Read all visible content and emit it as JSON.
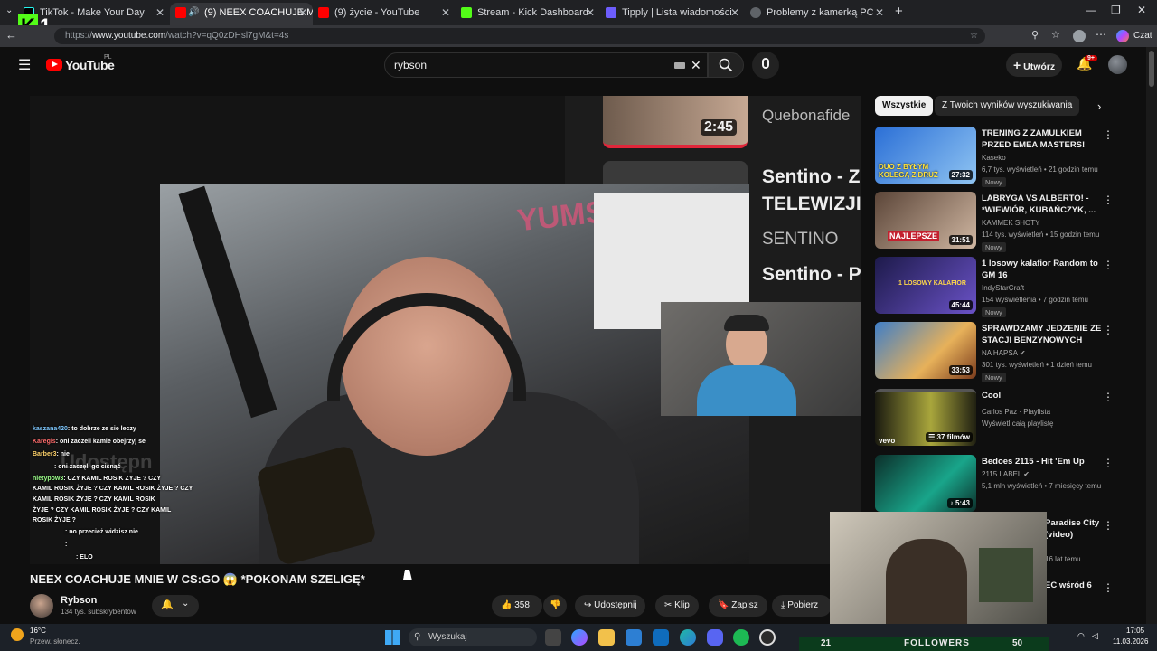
{
  "browser": {
    "tabs": [
      {
        "label": "TikTok - Make Your Day"
      },
      {
        "label": "(9) NEEX COACHUJE MNIE W"
      },
      {
        "label": "(9) życie - YouTube"
      },
      {
        "label": "Stream - Kick Dashboard"
      },
      {
        "label": "Tipply | Lista wiadomości"
      },
      {
        "label": "Problemy z kamerką PC"
      }
    ],
    "new_tab": "+",
    "url_prefix": "https://",
    "url_host": "www.youtube.com",
    "url_path": "/watch?v=qQ0zDHsl7gM&t=4s",
    "chat_label": "Czat"
  },
  "overlay": {
    "kick_logo": "K",
    "kick_number": "1"
  },
  "youtube": {
    "logo": "YouTube",
    "logo_region": "PL",
    "search_value": "rybson",
    "create_label": "Utwórz",
    "notif_count": "9+"
  },
  "video": {
    "title": "NEEX COACHUJE MNIE W CS:GO 😱 *POKONAM SZELIGĘ*",
    "channel": "Rybson",
    "subscribers": "134 tys. subskrybentów",
    "likes": "358",
    "share": "Udostępnij",
    "clip": "Klip",
    "save": "Zapisz",
    "download": "Pobierz",
    "inner_watermark": "Udostępn",
    "inner_text": [
      {
        "text": "Quebonafide"
      },
      {
        "text": "Sentino - Z"
      },
      {
        "text": "TELEWIZJI"
      },
      {
        "text": "SENTINO"
      },
      {
        "text": "Sentino - P"
      }
    ],
    "inner_duration": "2:45",
    "wall_text": "YUMSU"
  },
  "chat": [
    {
      "user": "kaszana420",
      "msg": ": to dobrze ze sie leczy"
    },
    {
      "user": "Karegis",
      "msg": ": oni zaczeli kamie obejrzyj se"
    },
    {
      "user": "Barber3",
      "msg": ": nie"
    },
    {
      "user": "",
      "msg": ": oni zaczęli go cisnąć"
    },
    {
      "user": "nietypow3",
      "msg": ": CZY KAMIL ROSIK ŻYJE ? CZY"
    },
    {
      "user": "",
      "msg": "KAMIL ROSIK ŻYJE ? CZY KAMIL ROSIK ŻYJE ? CZY"
    },
    {
      "user": "",
      "msg": "KAMIL ROSIK ŻYJE ? CZY KAMIL ROSIK"
    },
    {
      "user": "",
      "msg": "ŻYJE ? CZY KAMIL ROSIK ŻYJE ? CZY KAMIL"
    },
    {
      "user": "",
      "msg": "ROSIK ŻYJE ?"
    },
    {
      "user": "",
      "msg": ": no przecież widzisz nie"
    },
    {
      "user": "",
      "msg": ":"
    },
    {
      "user": "",
      "msg": ": ELO"
    }
  ],
  "sidebar": {
    "chips": [
      {
        "label": "Wszystkie"
      },
      {
        "label": "Z Twoich wyników wyszukiwania"
      }
    ],
    "recs": [
      {
        "title": "TRENING Z ZAMULKIEM PRZED EMEA MASTERS!",
        "channel": "Kaseko",
        "meta": "6,7 tys. wyświetleń • 21 godzin temu",
        "badge": "Nowy",
        "duration": "27:32",
        "thumb_text": "DUO Z BYŁYM KOLEGĄ Z DRUŻ"
      },
      {
        "title": "LABRYGA VS ALBERTO! - *WIEWIÓR, KUBAŃCZYK, ...",
        "channel": "KAMMEK SHOTY",
        "meta": "114 tys. wyświetleń • 15 godzin temu",
        "badge": "Nowy",
        "duration": "31:51",
        "thumb_text": "NAJLEPSZE"
      },
      {
        "title": "1 losowy kalafior Random to GM 16",
        "channel": "IndyStarCraft",
        "meta": "154 wyświetlenia • 7 godzin temu",
        "badge": "Nowy",
        "duration": "45:44",
        "thumb_text": "1 LOSOWY KALAFIOR"
      },
      {
        "title": "SPRAWDZAMY JEDZENIE ZE STACJI BENZYNOWYCH",
        "channel": "NA HAPSA",
        "meta": "301 tys. wyświetleń • 1 dzień temu",
        "badge": "Nowy",
        "duration": "33:53",
        "thumb_text": ""
      },
      {
        "title": "Cool",
        "channel": "Carlos Paz · Playlista",
        "meta": "Wyświetl całą playlistę",
        "badge": "",
        "duration": "37 filmów",
        "thumb_text": "vevo"
      },
      {
        "title": "Bedoes 2115 - Hit 'Em Up",
        "channel": "2115 LABEL",
        "meta": "5,1 mln wyświetleń • 7 miesięcy temu",
        "badge": "",
        "duration": "5:43",
        "thumb_text": ""
      },
      {
        "title": "Paradise City (video)",
        "channel": "",
        "meta": "16 lat temu",
        "badge": "",
        "duration": "",
        "thumb_text": ""
      },
      {
        "title": "EC wśród 6",
        "channel": "",
        "meta": "",
        "badge": "",
        "duration": "",
        "thumb_text": ""
      }
    ]
  },
  "taskbar": {
    "temp": "16°C",
    "weather": "Przew. słonecz.",
    "search_placeholder": "Wyszukaj",
    "time": "17:05",
    "date": "11.03.2026"
  },
  "followers": {
    "current": "21",
    "label": "FOLLOWERS",
    "goal": "50"
  },
  "colors": {
    "accent_red": "#ff0000",
    "kick_green": "#53fc18",
    "chip_active": "#f1f1f1",
    "followers_bg": "#0b3b1c"
  }
}
